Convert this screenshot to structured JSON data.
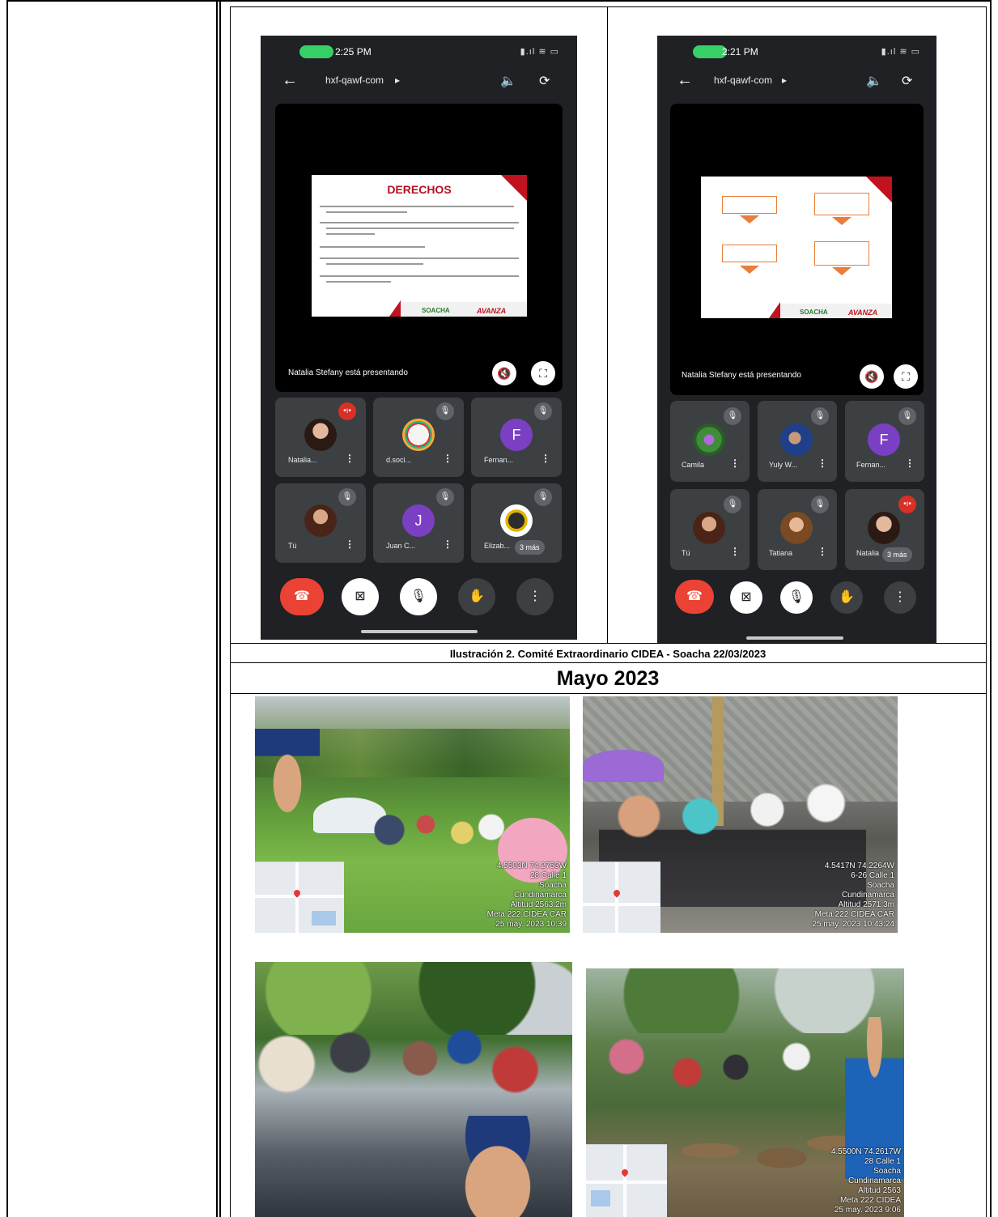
{
  "call_left": {
    "time": "2:25 PM",
    "meeting_code": "hxf-qawf-com",
    "slide_title": "DERECHOS",
    "slide_footer_logo": "SOACHA",
    "slide_footer_slogan": "AVANZA",
    "presenting_text": "Natalia Stefany está presentando",
    "participants": [
      {
        "name": "Natalia..."
      },
      {
        "name": "d.soci..."
      },
      {
        "name": "Fernan...",
        "initial": "F"
      },
      {
        "name": "Tú"
      },
      {
        "name": "Juan C...",
        "initial": "J"
      },
      {
        "name": "Elizab...",
        "more": "3 más"
      }
    ]
  },
  "call_right": {
    "time": "2:21 PM",
    "meeting_code": "hxf-qawf-com",
    "slide_footer_logo": "SOACHA",
    "slide_footer_slogan": "AVANZA",
    "presenting_text": "Natalia Stefany está presentando",
    "participants": [
      {
        "name": "Camila"
      },
      {
        "name": "Yuly W..."
      },
      {
        "name": "Fernan...",
        "initial": "F"
      },
      {
        "name": "Tú"
      },
      {
        "name": "Tatiana"
      },
      {
        "name": "Natalia",
        "more": "3 más"
      }
    ]
  },
  "caption": "Ilustración 2. Comité Extraordinario CIDEA - Soacha 22/03/2023",
  "section_heading": "Mayo 2023",
  "photos": [
    {
      "stamp": [
        "4.5503N 74.2753W",
        "28 Calle 1",
        "Soacha",
        "Cundinamarca",
        "Altitud 2563.2m",
        "Meta 222 CIDEA CAR",
        "25 may. 2023 10:39"
      ]
    },
    {
      "stamp": [
        "4.5417N 74.2264W",
        "6-26 Calle 1",
        "Soacha",
        "Cundinamarca",
        "Altitud 2571.3m",
        "Meta 222 CIDEA CAR",
        "25 may. 2023 10:43:24"
      ]
    },
    {
      "stamp": []
    },
    {
      "stamp": [
        "4.5500N 74.2617W",
        "28 Calle 1",
        "Soacha",
        "Cundinamarca",
        "Altitud 2563",
        "Meta 222 CIDEA",
        "25 may. 2023 9:06"
      ]
    }
  ],
  "colors": {
    "meet_bg": "#202124",
    "tile_bg": "#3c4043",
    "end_call": "#ea4335",
    "accent_purple": "#7b3fc4",
    "slide_red": "#c1121f"
  }
}
